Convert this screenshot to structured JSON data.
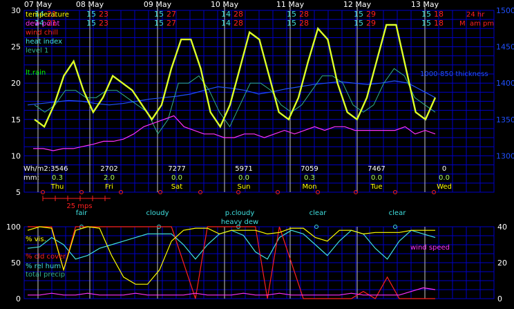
{
  "colors": {
    "grid": "#0000c8",
    "day_line": "#c8c8c8",
    "white": "#ffffff",
    "yellow": "#ffff00",
    "red": "#ff2020",
    "cyan": "#40e0e0",
    "magenta": "#ff30ff",
    "green": "#00ff00",
    "teal": "#30b090",
    "blue": "#2050ff",
    "lightgreen": "#b0ff60",
    "axis_right": "#2050ff"
  },
  "days": [
    {
      "date": "07 May",
      "dow": "Thu",
      "hi": "21",
      "lo": "14",
      "wh": "Wh/m2:3546",
      "mm": "0.3",
      "sky": "fair"
    },
    {
      "date": "08 May",
      "dow": "Fri",
      "hi": "23",
      "lo": "15",
      "wh": "2702",
      "mm": "2.0",
      "sky": "cloudy"
    },
    {
      "date": "09 May",
      "dow": "Sat",
      "hi": "27",
      "lo": "15",
      "wh": "7277",
      "mm": "0.0",
      "sky": "p.cloudy"
    },
    {
      "date": "10 May",
      "dow": "Sun",
      "hi": "28",
      "lo": "14",
      "wh": "5971",
      "mm": "0.0",
      "sky": "clear"
    },
    {
      "date": "11 May",
      "dow": "Mon",
      "hi": "28",
      "lo": "15",
      "wh": "7059",
      "mm": "0.3",
      "sky": "clear"
    },
    {
      "date": "12 May",
      "dow": "Tue",
      "hi": "29",
      "lo": "15",
      "wh": "7467",
      "mm": "0.0",
      "sky": ""
    },
    {
      "date": "13 May",
      "dow": "Wed",
      "hi": "18",
      "lo": "15",
      "wh": "0",
      "mm": "0.0",
      "sky": ""
    }
  ],
  "last_day_extra": {
    "hr_label": "24 hr",
    "am_pm": "M",
    "am_pm_label": "am pm"
  },
  "mm_label": "mm:",
  "heavy_dew_label": "heavy dew",
  "wind_scale_label": "25 mps",
  "top_legend": [
    "temperature",
    "dew point",
    "wind chill",
    "heat index",
    "level 1"
  ],
  "top_legend_colors": [
    "#ffff00",
    "#ff30ff",
    "#ff2020",
    "#40e0e0",
    "#30b090"
  ],
  "lt_rain_label": "lt.rain",
  "thickness_label": "1000-850 thickness",
  "bottom_legend": [
    "% vis.",
    "% cld cover",
    "% rel hum",
    "total precip"
  ],
  "bottom_legend_colors": [
    "#ffff00",
    "#ff2020",
    "#40e0e0",
    "#30b090"
  ],
  "wind_speed_label": "wind speed",
  "chart_data": [
    {
      "type": "line",
      "title": "",
      "y_left_ticks": [
        "30",
        "25",
        "20",
        "15",
        "10",
        "5"
      ],
      "y_right_ticks": [
        "1500",
        "1450",
        "1400",
        "1350",
        "1300"
      ],
      "ylim_left": [
        5,
        30
      ],
      "ylim_right": [
        1250,
        1500
      ],
      "x_categories": [
        "07 May",
        "08 May",
        "09 May",
        "10 May",
        "11 May",
        "12 May",
        "13 May"
      ],
      "series": [
        {
          "name": "temperature",
          "values": [
            15,
            14,
            17,
            21,
            23,
            19,
            16,
            18,
            21,
            20,
            19,
            17,
            15,
            17,
            22,
            26,
            26,
            22,
            16,
            14,
            17,
            22,
            27,
            26,
            21,
            16,
            15,
            18,
            23,
            27.5,
            26,
            20,
            16,
            15,
            18,
            23,
            28,
            28,
            22,
            16,
            15,
            18
          ]
        },
        {
          "name": "dew point",
          "values": [
            11,
            11,
            10.7,
            11,
            11,
            11.3,
            11.6,
            12,
            12,
            12.3,
            13,
            14,
            14.5,
            15,
            15.5,
            14,
            13.5,
            13,
            13,
            12.5,
            12.5,
            13,
            13,
            12.5,
            13,
            13.5,
            13,
            13.5,
            14,
            13.5,
            14,
            14,
            13.5,
            13.5,
            13.5,
            13.5,
            13.5,
            14,
            13,
            13.5,
            13
          ]
        },
        {
          "name": "level 1",
          "values": [
            17,
            16,
            17,
            19,
            19,
            18,
            18,
            19,
            19,
            18,
            17,
            16,
            13,
            15,
            20,
            20,
            21,
            19,
            16,
            14,
            17,
            20,
            20,
            19,
            17,
            16,
            17,
            19,
            21,
            21,
            20,
            17,
            16,
            17,
            20,
            22,
            21,
            18,
            17,
            16
          ]
        },
        {
          "name": "1000-850 thickness",
          "values": [
            1370,
            1372,
            1374,
            1376,
            1375,
            1372,
            1370,
            1372,
            1375,
            1378,
            1380,
            1382,
            1385,
            1390,
            1395,
            1393,
            1390,
            1385,
            1388,
            1392,
            1395,
            1398,
            1400,
            1402,
            1400,
            1398,
            1400,
            1403,
            1400,
            1390,
            1380
          ]
        }
      ],
      "daily_high": [
        21,
        23,
        27,
        28,
        28,
        29,
        18
      ],
      "daily_low": [
        14,
        15,
        15,
        14,
        15,
        15,
        15
      ]
    },
    {
      "type": "line",
      "title": "",
      "y_left_ticks": [
        "100",
        "50",
        "0"
      ],
      "y_right_ticks": [
        "40",
        "20",
        "0"
      ],
      "ylim_left": [
        0,
        100
      ],
      "ylim_right": [
        0,
        40
      ],
      "series": [
        {
          "name": "% vis.",
          "values": [
            95,
            100,
            98,
            40,
            95,
            100,
            98,
            60,
            30,
            20,
            20,
            40,
            80,
            95,
            98,
            98,
            90,
            95,
            95,
            95,
            90,
            92,
            98,
            98,
            85,
            80,
            95,
            95,
            90,
            92,
            92,
            92,
            95,
            95,
            95
          ]
        },
        {
          "name": "% cld cover",
          "values": [
            100,
            100,
            100,
            40,
            100,
            100,
            100,
            100,
            100,
            100,
            100,
            100,
            100,
            50,
            0,
            100,
            100,
            100,
            100,
            100,
            0,
            100,
            50,
            0,
            0,
            0,
            0,
            0,
            10,
            0,
            30,
            0,
            0,
            0,
            0
          ]
        },
        {
          "name": "% rel hum",
          "values": [
            70,
            72,
            85,
            75,
            55,
            60,
            70,
            75,
            80,
            85,
            90,
            90,
            90,
            75,
            55,
            75,
            90,
            95,
            88,
            65,
            55,
            85,
            95,
            90,
            75,
            60,
            80,
            95,
            90,
            70,
            55,
            80,
            95,
            90,
            85
          ]
        },
        {
          "name": "total precip",
          "values": [
            0,
            0,
            0,
            0,
            0,
            0,
            0,
            0,
            0,
            0,
            0,
            0,
            0,
            0,
            0,
            0,
            0,
            0,
            0,
            0,
            0,
            0,
            0,
            0,
            0,
            0,
            0,
            0,
            0,
            0,
            0,
            0,
            0,
            0,
            0
          ]
        },
        {
          "name": "wind speed",
          "values": [
            2,
            2,
            3,
            2,
            2,
            3,
            2,
            2,
            2,
            3,
            2,
            2,
            2,
            2,
            3,
            2,
            2,
            2,
            3,
            2,
            2,
            3,
            2,
            2,
            2,
            2,
            2,
            3,
            2,
            2,
            2,
            2,
            4,
            6,
            5
          ]
        }
      ]
    }
  ]
}
